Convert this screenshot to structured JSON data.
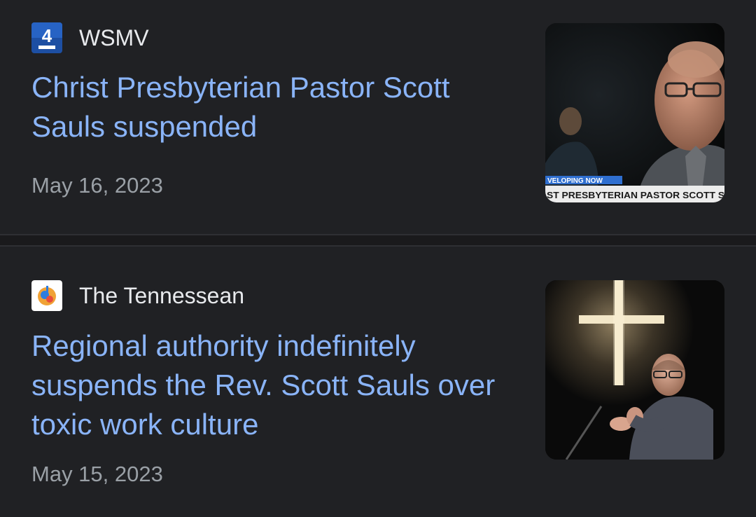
{
  "articles": [
    {
      "source": "WSMV",
      "source_icon": "wsmv-4-logo-icon",
      "headline": "Christ Presbyterian Pastor Scott Sauls suspended",
      "date": "May 16, 2023",
      "thumbnail": {
        "ticker_top": "VELOPING NOW",
        "ticker_bottom": "ST PRESBYTERIAN PASTOR SCOTT S"
      }
    },
    {
      "source": "The Tennessean",
      "source_icon": "tennessean-logo-icon",
      "headline": "Regional authority indefinitely suspends the Rev. Scott Sauls over toxic work culture",
      "date": "May 15, 2023",
      "thumbnail": {}
    }
  ],
  "colors": {
    "background": "#202124",
    "headline": "#8ab4f8",
    "source": "#e8eaed",
    "date": "#9aa0a6"
  }
}
